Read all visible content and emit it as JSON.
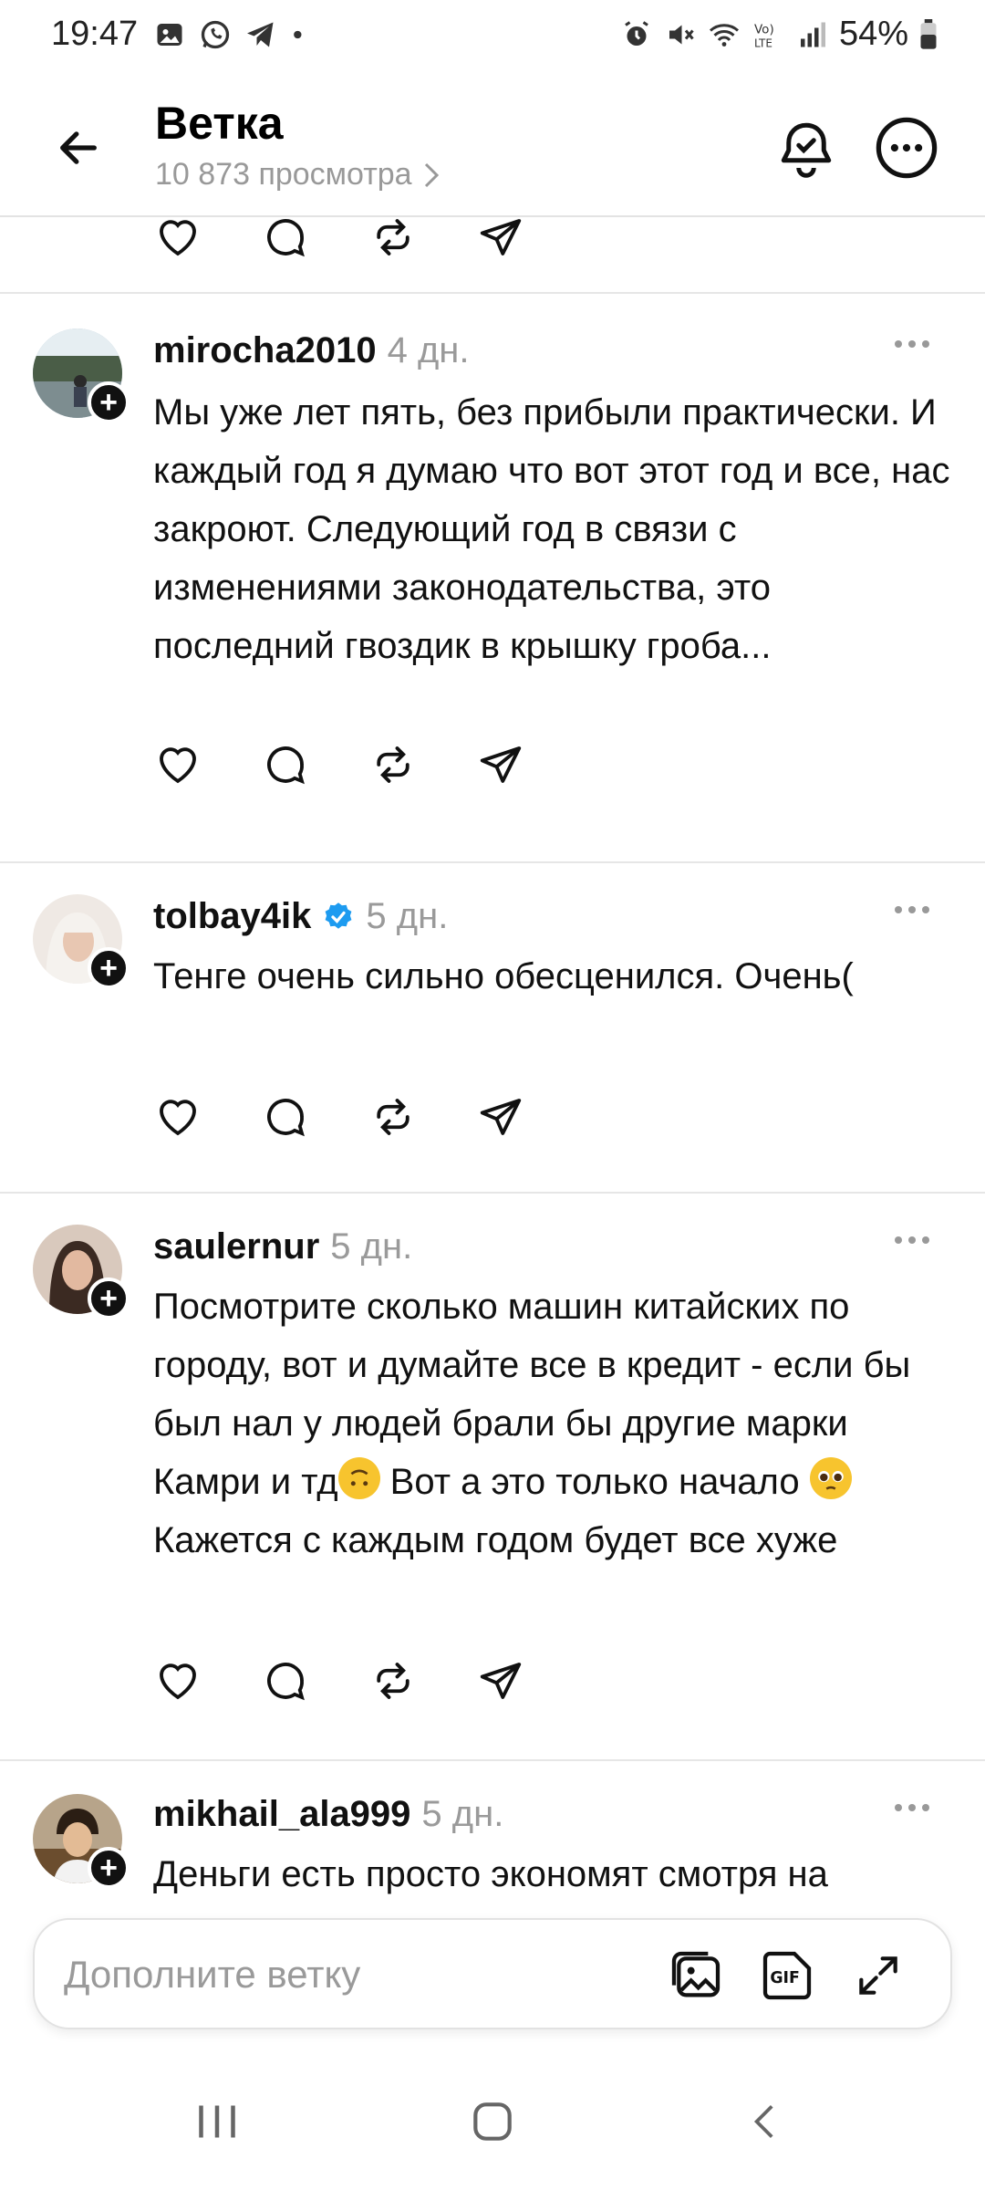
{
  "status_bar": {
    "time": "19:47",
    "battery": "54%",
    "left_icons": [
      "gallery-icon",
      "whatsapp-icon",
      "telegram-icon",
      "dot-icon"
    ],
    "right_icons": [
      "alarm-icon",
      "mute-icon",
      "wifi-icon",
      "volte-icon",
      "signal-icon",
      "battery-icon"
    ]
  },
  "header": {
    "title": "Ветка",
    "views": "10 873 просмотра",
    "icons": [
      "back-icon",
      "bell-check-icon",
      "more-circle-icon"
    ]
  },
  "posts": [
    {
      "username": "mirocha2010",
      "time": "4 дн.",
      "verified": false,
      "text": "Мы уже лет пять, без прибыли практически. И каждый год я думаю что вот этот год и все, нас закроют. Следующий год в связи с изменениями законодательства, это последний гвоздик в крышку гроба..."
    },
    {
      "username": "tolbay4ik",
      "time": "5 дн.",
      "verified": true,
      "text": "Тенге очень сильно обесценился. Очень("
    },
    {
      "username": "saulernur",
      "time": "5 дн.",
      "verified": false,
      "text_part1": "Посмотрите сколько машин китайских по городу, вот и думайте все в кредит - если бы был нал у людей брали бы другие марки Камри и тд",
      "text_part2": " Вот а это только начало ",
      "text_part3": " Кажется с каждым годом будет все хуже",
      "emoji": [
        "upside-down-face",
        "pleading-face"
      ]
    },
    {
      "username": "mikhail_ala999",
      "time": "5 дн.",
      "verified": false,
      "text": "Деньги есть просто экономят смотря на"
    }
  ],
  "action_icons": [
    "heart-icon",
    "comment-icon",
    "repost-icon",
    "share-icon"
  ],
  "composer": {
    "placeholder": "Дополните ветку",
    "icons": [
      "gallery-icon",
      "gif-icon",
      "expand-icon"
    ]
  },
  "nav": {
    "icons": [
      "recents-icon",
      "home-icon",
      "back-nav-icon"
    ]
  }
}
